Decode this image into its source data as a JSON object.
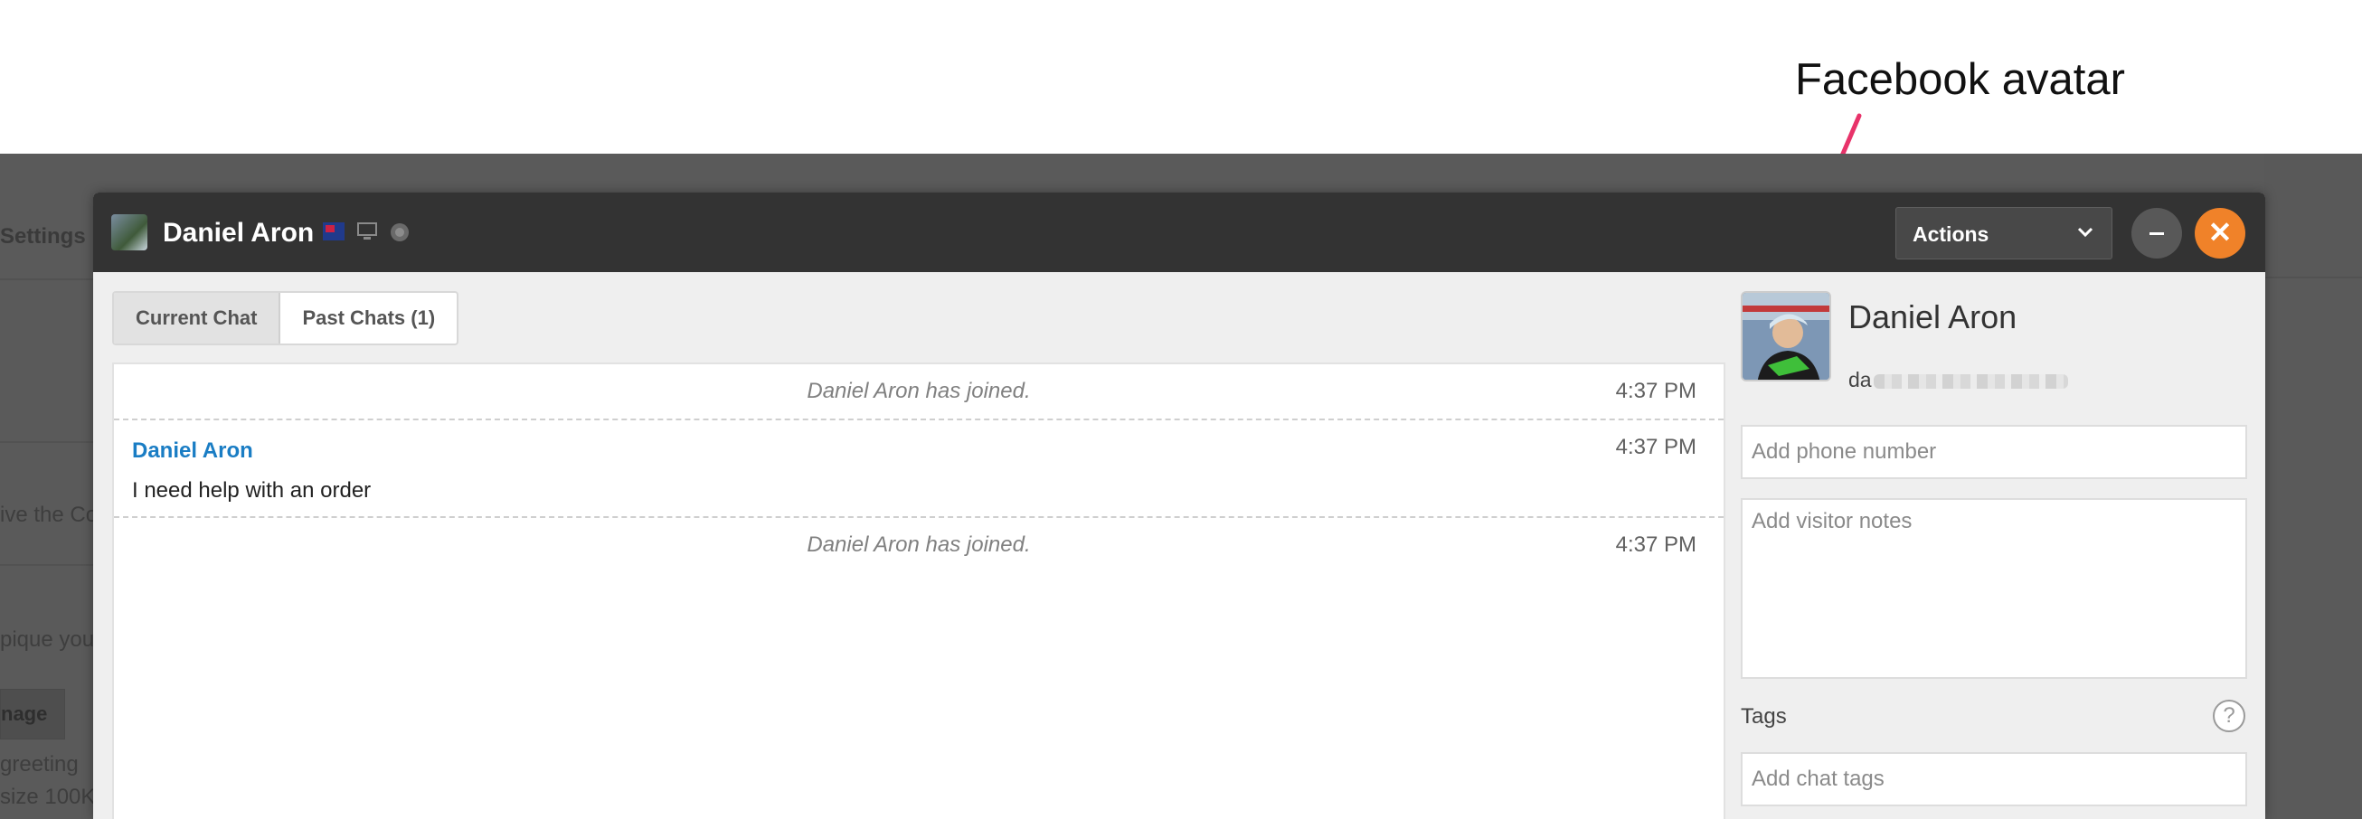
{
  "annotation": {
    "label": "Facebook avatar",
    "arrow_color": "#e8336a"
  },
  "background_app": {
    "tab_label": "Settings",
    "text_1": "ive the Co",
    "text_2": "pique you",
    "button_label": "nage",
    "text_3": "greeting",
    "text_4": "size 100K"
  },
  "chat_window": {
    "visitor_name": "Daniel Aron",
    "icons": [
      "flag-icon",
      "desktop-icon",
      "browser-icon"
    ],
    "actions_label": "Actions",
    "close_symbol": "✕",
    "accent_color": "#f08229",
    "tabs": [
      {
        "label": "Current Chat",
        "active": true
      },
      {
        "label": "Past Chats (1)",
        "active": false
      }
    ],
    "transcript": [
      {
        "type": "system",
        "text": "Daniel Aron has joined.",
        "time": "4:37 PM"
      },
      {
        "type": "message",
        "sender": "Daniel Aron",
        "text": "I need help with an order",
        "time": "4:37 PM"
      },
      {
        "type": "system",
        "text": "Daniel Aron has joined.",
        "time": "4:37 PM"
      }
    ],
    "visitor_panel": {
      "name": "Daniel Aron",
      "email_prefix": "da",
      "phone_placeholder": "Add phone number",
      "notes_placeholder": "Add visitor notes",
      "tags_label": "Tags",
      "help_symbol": "?",
      "tags_placeholder": "Add chat tags"
    }
  }
}
